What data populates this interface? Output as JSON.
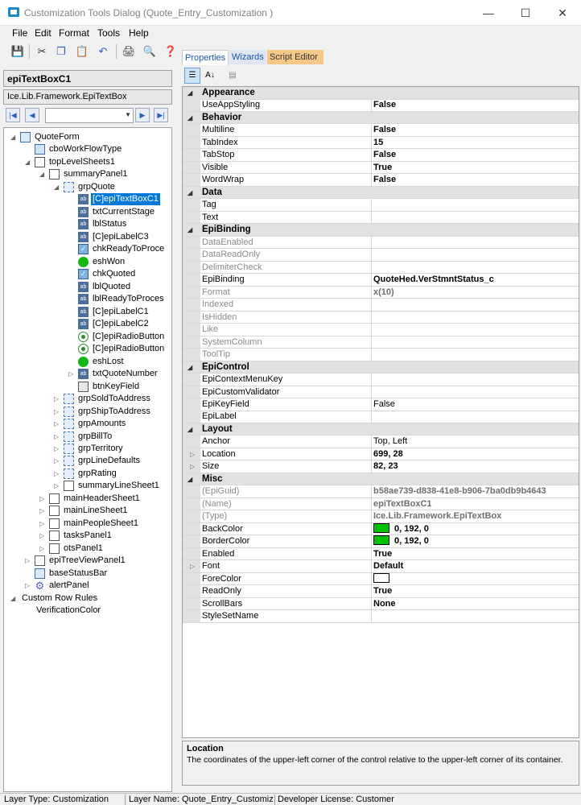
{
  "window": {
    "title": "Customization Tools Dialog  (Quote_Entry_Customization )",
    "minimize_icon": "minimize-icon",
    "maximize_icon": "maximize-icon",
    "close_icon": "close-icon"
  },
  "menu": [
    "File",
    "Edit",
    "Format",
    "Tools",
    "Help"
  ],
  "toolbar": [
    "save-icon",
    "cut-icon",
    "copy-icon",
    "paste-icon",
    "undo-icon",
    "print-icon",
    "print-preview-icon",
    "help-icon"
  ],
  "control": {
    "name": "epiTextBoxC1",
    "type": "Ice.Lib.Framework.EpiTextBox",
    "nav_combo_value": ""
  },
  "nav_icons": [
    "first-icon",
    "previous-icon",
    "next-icon",
    "last-icon"
  ],
  "tree": [
    {
      "label": "QuoteForm",
      "level": 0,
      "exp": "open",
      "icon": "form"
    },
    {
      "label": "cboWorkFlowType",
      "level": 1,
      "exp": "",
      "icon": "combo"
    },
    {
      "label": "topLevelSheets1",
      "level": 1,
      "exp": "open",
      "icon": "sheet"
    },
    {
      "label": "summaryPanel1",
      "level": 2,
      "exp": "open",
      "icon": "sheet"
    },
    {
      "label": "grpQuote",
      "level": 3,
      "exp": "open",
      "icon": "group"
    },
    {
      "label": "[C]epiTextBoxC1",
      "level": 4,
      "exp": "",
      "icon": "text",
      "selected": true
    },
    {
      "label": "txtCurrentStage",
      "level": 4,
      "exp": "",
      "icon": "text"
    },
    {
      "label": "lblStatus",
      "level": 4,
      "exp": "",
      "icon": "text"
    },
    {
      "label": "[C]epiLabelC3",
      "level": 4,
      "exp": "",
      "icon": "text"
    },
    {
      "label": "chkReadyToProce",
      "level": 4,
      "exp": "",
      "icon": "check"
    },
    {
      "label": "eshWon",
      "level": 4,
      "exp": "",
      "icon": "shape"
    },
    {
      "label": "chkQuoted",
      "level": 4,
      "exp": "",
      "icon": "check"
    },
    {
      "label": "lblQuoted",
      "level": 4,
      "exp": "",
      "icon": "text"
    },
    {
      "label": "lblReadyToProces",
      "level": 4,
      "exp": "",
      "icon": "text"
    },
    {
      "label": "[C]epiLabelC1",
      "level": 4,
      "exp": "",
      "icon": "text"
    },
    {
      "label": "[C]epiLabelC2",
      "level": 4,
      "exp": "",
      "icon": "text"
    },
    {
      "label": "[C]epiRadioButton",
      "level": 4,
      "exp": "",
      "icon": "radio"
    },
    {
      "label": "[C]epiRadioButton",
      "level": 4,
      "exp": "",
      "icon": "radio"
    },
    {
      "label": "eshLost",
      "level": 4,
      "exp": "",
      "icon": "shape"
    },
    {
      "label": "txtQuoteNumber",
      "level": 4,
      "exp": "closed",
      "icon": "text"
    },
    {
      "label": "btnKeyField",
      "level": 4,
      "exp": "",
      "icon": "button"
    },
    {
      "label": "grpSoldToAddress",
      "level": 3,
      "exp": "closed",
      "icon": "group"
    },
    {
      "label": "grpShipToAddress",
      "level": 3,
      "exp": "closed",
      "icon": "group"
    },
    {
      "label": "grpAmounts",
      "level": 3,
      "exp": "closed",
      "icon": "group"
    },
    {
      "label": "grpBillTo",
      "level": 3,
      "exp": "closed",
      "icon": "group"
    },
    {
      "label": "grpTerritory",
      "level": 3,
      "exp": "closed",
      "icon": "group"
    },
    {
      "label": "grpLineDefaults",
      "level": 3,
      "exp": "closed",
      "icon": "group"
    },
    {
      "label": "grpRating",
      "level": 3,
      "exp": "closed",
      "icon": "group"
    },
    {
      "label": "summaryLineSheet1",
      "level": 3,
      "exp": "closed",
      "icon": "sheet"
    },
    {
      "label": "mainHeaderSheet1",
      "level": 2,
      "exp": "closed",
      "icon": "sheet"
    },
    {
      "label": "mainLineSheet1",
      "level": 2,
      "exp": "closed",
      "icon": "sheet"
    },
    {
      "label": "mainPeopleSheet1",
      "level": 2,
      "exp": "closed",
      "icon": "sheet"
    },
    {
      "label": "tasksPanel1",
      "level": 2,
      "exp": "closed",
      "icon": "sheet"
    },
    {
      "label": "otsPanel1",
      "level": 2,
      "exp": "closed",
      "icon": "sheet"
    },
    {
      "label": "epiTreeViewPanel1",
      "level": 1,
      "exp": "closed",
      "icon": "sheet"
    },
    {
      "label": "baseStatusBar",
      "level": 1,
      "exp": "",
      "icon": "status"
    },
    {
      "label": "alertPanel",
      "level": 1,
      "exp": "closed",
      "icon": "gear"
    },
    {
      "label": "Custom Row Rules",
      "level": 0,
      "exp": "open",
      "icon": "none"
    },
    {
      "label": "VerificationColor",
      "level": 1,
      "exp": "",
      "icon": "none"
    }
  ],
  "tabs": {
    "properties": "Properties",
    "wizards": "Wizards",
    "script_editor": "Script Editor"
  },
  "grid_toolbar_icons": [
    "categorized-icon",
    "alphabetical-icon",
    "property-pages-icon"
  ],
  "colors": {
    "selection": "#0078d7",
    "green_swatch": "#00c000",
    "script_tab": "#f5c88a"
  },
  "properties": [
    {
      "kind": "cat",
      "name": "Appearance"
    },
    {
      "name": "UseAppStyling",
      "value": "False",
      "bold": true
    },
    {
      "kind": "cat",
      "name": "Behavior"
    },
    {
      "name": "Multiline",
      "value": "False",
      "bold": true
    },
    {
      "name": "TabIndex",
      "value": "15",
      "bold": true
    },
    {
      "name": "TabStop",
      "value": "False",
      "bold": true
    },
    {
      "name": "Visible",
      "value": "True",
      "bold": true
    },
    {
      "name": "WordWrap",
      "value": "False",
      "bold": true
    },
    {
      "kind": "cat",
      "name": "Data"
    },
    {
      "name": "Tag",
      "value": ""
    },
    {
      "name": "Text",
      "value": ""
    },
    {
      "kind": "cat",
      "name": "EpiBinding"
    },
    {
      "name": "DataEnabled",
      "value": "",
      "dim": true
    },
    {
      "name": "DataReadOnly",
      "value": "",
      "dim": true
    },
    {
      "name": "DelimiterCheck",
      "value": "",
      "dim": true
    },
    {
      "name": "EpiBinding",
      "value": "QuoteHed.VerStmntStatus_c",
      "bold": true
    },
    {
      "name": "Format",
      "value": "x(10)",
      "dim": true,
      "valdim": true
    },
    {
      "name": "Indexed",
      "value": "",
      "dim": true
    },
    {
      "name": "IsHidden",
      "value": "",
      "dim": true
    },
    {
      "name": "Like",
      "value": "",
      "dim": true
    },
    {
      "name": "SystemColumn",
      "value": "",
      "dim": true
    },
    {
      "name": "ToolTip",
      "value": "",
      "dim": true
    },
    {
      "kind": "cat",
      "name": "EpiControl"
    },
    {
      "name": "EpiContextMenuKey",
      "value": ""
    },
    {
      "name": "EpiCustomValidator",
      "value": ""
    },
    {
      "name": "EpiKeyField",
      "value": "False"
    },
    {
      "name": "EpiLabel",
      "value": ""
    },
    {
      "kind": "cat",
      "name": "Layout"
    },
    {
      "name": "Anchor",
      "value": "Top, Left"
    },
    {
      "name": "Location",
      "value": "699, 28",
      "bold": true,
      "sub": true
    },
    {
      "name": "Size",
      "value": "82, 23",
      "bold": true,
      "sub": true
    },
    {
      "kind": "cat",
      "name": "Misc"
    },
    {
      "name": "(EpiGuid)",
      "value": "b58ae739-d838-41e8-b906-7ba0db9b4643",
      "dim": true,
      "valdim": true
    },
    {
      "name": "(Name)",
      "value": "epiTextBoxC1",
      "dim": true,
      "valdim": true
    },
    {
      "name": "(Type)",
      "value": "Ice.Lib.Framework.EpiTextBox",
      "dim": true,
      "valdim": true
    },
    {
      "name": "BackColor",
      "value": "0, 192, 0",
      "bold": true,
      "swatch": "#00c000"
    },
    {
      "name": "BorderColor",
      "value": "0, 192, 0",
      "bold": true,
      "swatch": "#00c000"
    },
    {
      "name": "Enabled",
      "value": "True",
      "bold": true
    },
    {
      "name": "Font",
      "value": "Default",
      "bold": true,
      "sub": true
    },
    {
      "name": "ForeColor",
      "value": "",
      "swatch": "#ffffff"
    },
    {
      "name": "ReadOnly",
      "value": "True",
      "bold": true
    },
    {
      "name": "ScrollBars",
      "value": "None",
      "bold": true
    },
    {
      "name": "StyleSetName",
      "value": ""
    }
  ],
  "description": {
    "title": "Location",
    "text": "The coordinates of the upper-left corner of the control relative to the upper-left corner of its container."
  },
  "status_bar": {
    "layer_type": "Layer Type:  Customization",
    "layer_name": "Layer Name:  Quote_Entry_Customizatio",
    "license": "Developer License:  Customer"
  }
}
